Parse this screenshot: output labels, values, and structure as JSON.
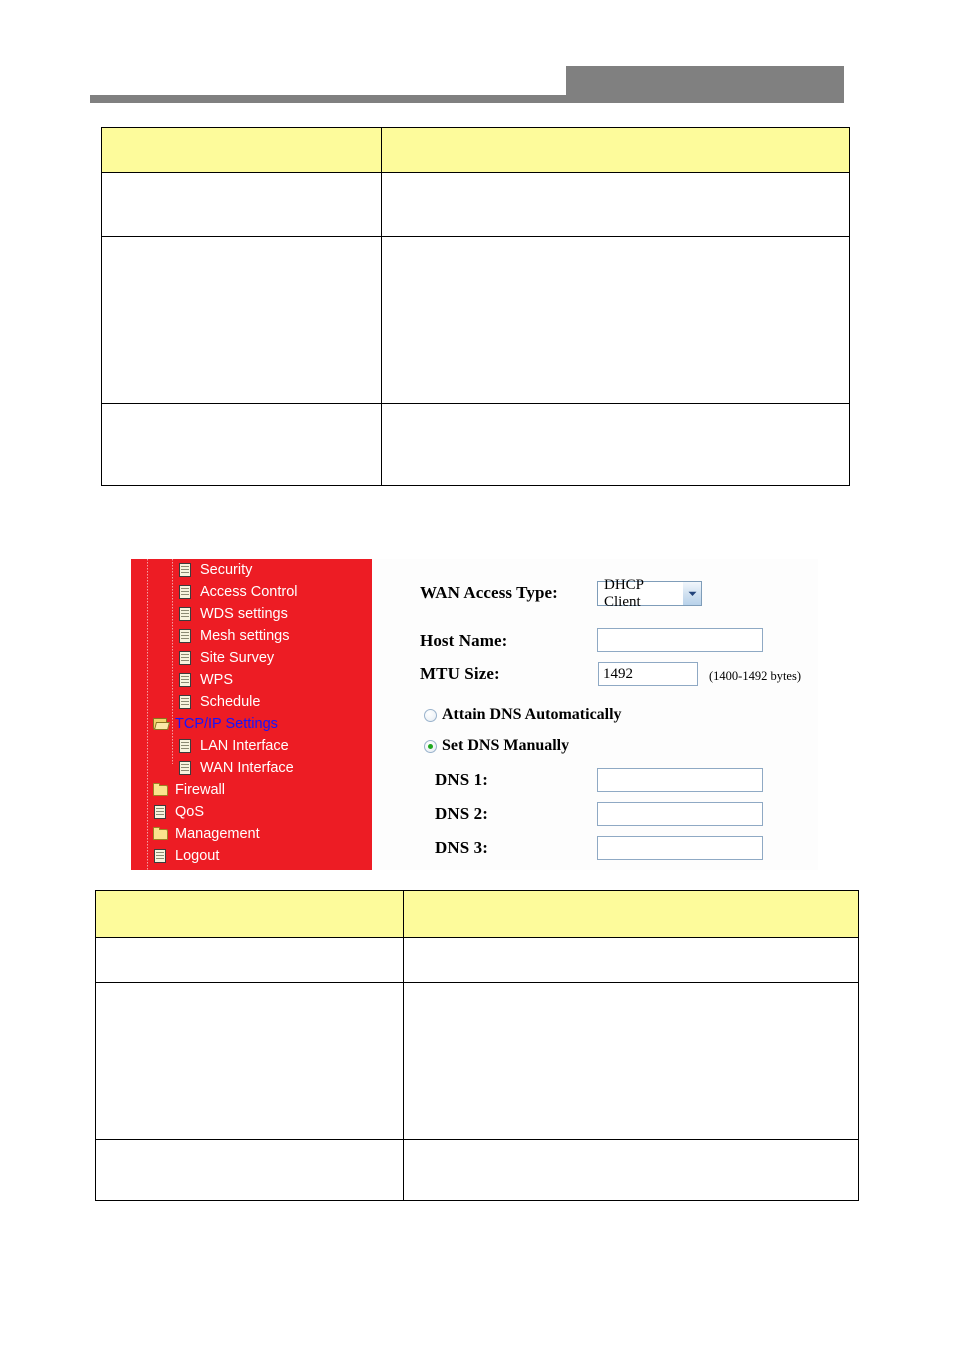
{
  "header": {
    "badge_label": "",
    "rule_label": ""
  },
  "table_top": {
    "columns": [
      "",
      ""
    ],
    "rows": [
      [
        "",
        ""
      ],
      [
        "",
        ""
      ],
      [
        "",
        ""
      ]
    ]
  },
  "table_bottom": {
    "columns": [
      "",
      ""
    ],
    "rows": [
      [
        "",
        ""
      ],
      [
        "",
        ""
      ],
      [
        "",
        ""
      ]
    ]
  },
  "figure": {
    "nav": {
      "background_color": "#ED1C24",
      "selected_color": "#1414FF",
      "items": [
        {
          "label": "Security",
          "icon": "page-icon",
          "level": 2,
          "selected": false
        },
        {
          "label": "Access Control",
          "icon": "page-icon",
          "level": 2,
          "selected": false
        },
        {
          "label": "WDS settings",
          "icon": "page-icon",
          "level": 2,
          "selected": false
        },
        {
          "label": "Mesh settings",
          "icon": "page-icon",
          "level": 2,
          "selected": false
        },
        {
          "label": "Site Survey",
          "icon": "page-icon",
          "level": 2,
          "selected": false
        },
        {
          "label": "WPS",
          "icon": "page-icon",
          "level": 2,
          "selected": false
        },
        {
          "label": "Schedule",
          "icon": "page-icon",
          "level": 2,
          "selected": false
        },
        {
          "label": "TCP/IP Settings",
          "icon": "folder-open-icon",
          "level": 1,
          "selected": true
        },
        {
          "label": "LAN Interface",
          "icon": "page-icon",
          "level": 2,
          "selected": false
        },
        {
          "label": "WAN Interface",
          "icon": "page-icon",
          "level": 2,
          "selected": false
        },
        {
          "label": "Firewall",
          "icon": "folder-icon",
          "level": 1,
          "selected": false
        },
        {
          "label": "QoS",
          "icon": "page-icon",
          "level": 1,
          "selected": false
        },
        {
          "label": "Management",
          "icon": "folder-icon",
          "level": 1,
          "selected": false
        },
        {
          "label": "Logout",
          "icon": "page-icon",
          "level": 1,
          "selected": false
        }
      ]
    },
    "form": {
      "wan_access_type": {
        "label": "WAN Access Type:",
        "value": "DHCP Client",
        "options": [
          "DHCP Client"
        ]
      },
      "host_name": {
        "label": "Host Name:",
        "value": "",
        "placeholder": ""
      },
      "mtu_size": {
        "label": "MTU Size:",
        "value": "1492",
        "hint": "(1400-1492 bytes)"
      },
      "dns_mode": {
        "attain_label": "Attain DNS Automatically",
        "attain_selected": false,
        "manual_label": "Set DNS Manually",
        "manual_selected": true
      },
      "dns_fields": [
        {
          "label": "DNS 1:",
          "value": ""
        },
        {
          "label": "DNS 2:",
          "value": ""
        },
        {
          "label": "DNS 3:",
          "value": ""
        }
      ]
    }
  }
}
